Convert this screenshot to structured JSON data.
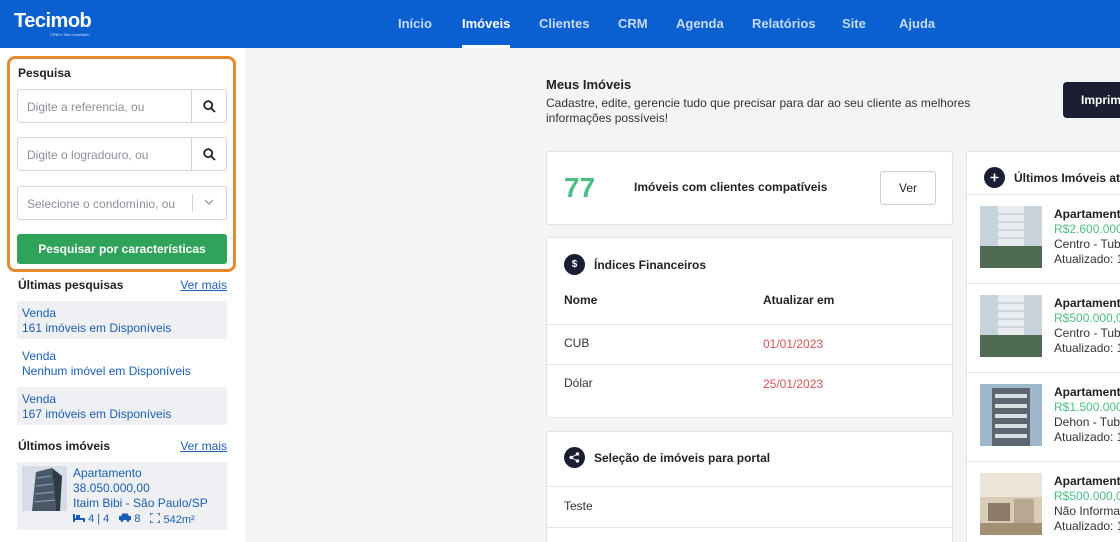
{
  "app": {
    "logo": "Tecimob",
    "logo_tagline": "CRM e Site imobiliário"
  },
  "nav": {
    "items": [
      {
        "label": "Início",
        "active": false
      },
      {
        "label": "Imóveis",
        "active": true
      },
      {
        "label": "Clientes",
        "active": false
      },
      {
        "label": "CRM",
        "active": false
      },
      {
        "label": "Agenda",
        "active": false
      },
      {
        "label": "Relatórios",
        "active": false
      },
      {
        "label": "Site",
        "active": false
      },
      {
        "label": "Ajuda",
        "active": false
      }
    ]
  },
  "sidebar": {
    "search_title": "Pesquisa",
    "reference_placeholder": "Digite a referencia, ou",
    "street_placeholder": "Digite o logradouro, ou",
    "condo_placeholder": "Selecione o condomínio, ou",
    "search_button": "Pesquisar por características",
    "recent_searches_title": "Últimas pesquisas",
    "recent_searches_link": "Ver mais",
    "recent_searches": [
      {
        "type": "Venda",
        "result": "161 imóveis em Disponíveis"
      },
      {
        "type": "Venda",
        "result": "Nenhum imóvel em Disponíveis"
      },
      {
        "type": "Venda",
        "result": "167 imóveis em Disponíveis"
      }
    ],
    "recent_properties_title": "Últimos imóveis",
    "recent_properties_link": "Ver mais",
    "recent_property": {
      "title": "Apartamento",
      "price": "38.050.000,00",
      "location": "Itaim Bibi - São Paulo/SP",
      "bedrooms": "4 | 4",
      "garage": "8",
      "area": "542m²"
    }
  },
  "main": {
    "title": "Meus Imóveis",
    "subtitle": "Cadastre, edite, gerencie tudo que precisar para dar ao seu cliente as melhores informações possíveis!",
    "print_button": "Imprim",
    "compatible": {
      "count": "77",
      "label": "Imóveis com clientes compatíveis",
      "button": "Ver"
    },
    "financial": {
      "icon_char": "$",
      "title": "Índices Financeiros",
      "col_name": "Nome",
      "col_update": "Atualizar em",
      "rows": [
        {
          "name": "CUB",
          "date": "01/01/2023"
        },
        {
          "name": "Dólar",
          "date": "25/01/2023"
        }
      ]
    },
    "portal": {
      "title": "Seleção de imóveis para portal",
      "rows": [
        "Teste"
      ]
    }
  },
  "recent_updates": {
    "title": "Últimos Imóveis atu",
    "items": [
      {
        "title": "Apartament",
        "price": "R$2.600.000,",
        "location": "Centro - Tub",
        "updated": "Atualizado: 1"
      },
      {
        "title": "Apartament",
        "price": "R$500.000,0",
        "location": "Centro - Tub",
        "updated": "Atualizado: 1"
      },
      {
        "title": "Apartament",
        "price": "R$1.500.000",
        "location": "Dehon - Tuba",
        "updated": "Atualizado: 1"
      },
      {
        "title": "Apartament",
        "price": "R$500.000,0",
        "location": "Não Informa",
        "updated": "Atualizado: 1"
      }
    ]
  },
  "colors": {
    "topbar": "#0a5fd1",
    "accent_orange": "#e7892d",
    "green": "#2fa35a",
    "price_green": "#4bbf82",
    "date_red": "#d9534f",
    "dark": "#1b1d33"
  }
}
